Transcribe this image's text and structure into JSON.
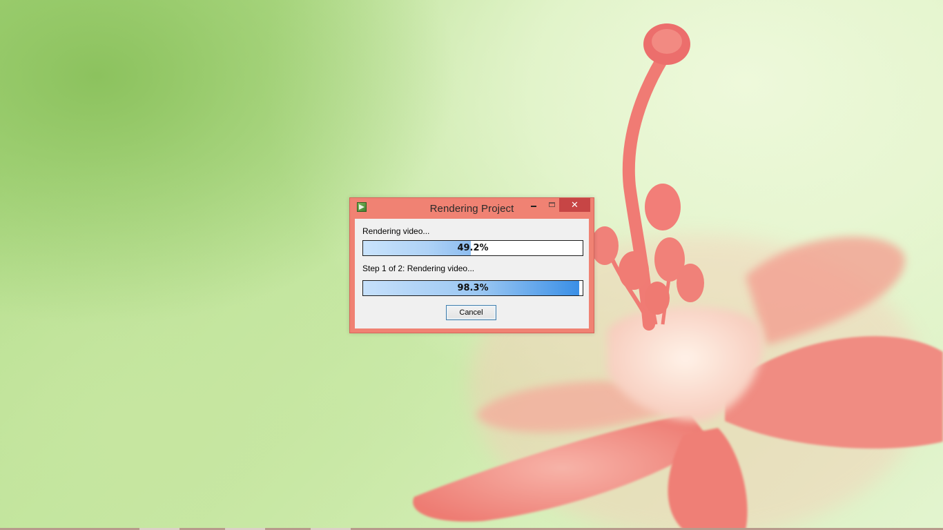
{
  "window": {
    "title": "Rendering Project",
    "close_glyph": "✕"
  },
  "progress": {
    "overall": {
      "label": "Rendering video...",
      "value_text": "49.2%",
      "fraction": 0.492
    },
    "step": {
      "label": "Step 1 of 2: Rendering video...",
      "value_text": "98.3%",
      "fraction": 0.983
    }
  },
  "buttons": {
    "cancel_label": "Cancel"
  },
  "icons": {
    "app": "app-icon",
    "minimize": "minimize-icon",
    "maximize": "maximize-icon",
    "close": "close-icon"
  },
  "colors": {
    "window_frame": "#f08273",
    "close_button": "#c74545",
    "progress_accent": "#3a8fe6"
  }
}
